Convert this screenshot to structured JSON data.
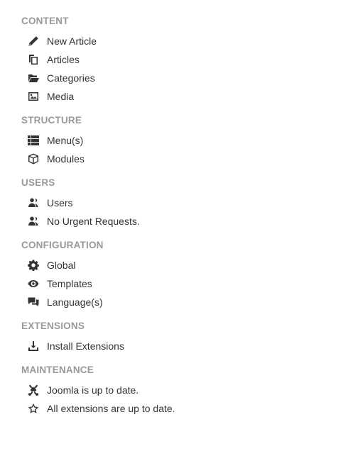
{
  "sections": {
    "content": {
      "title": "CONTENT",
      "items": [
        {
          "label": "New Article",
          "icon": "pencil-icon"
        },
        {
          "label": "Articles",
          "icon": "copy-icon"
        },
        {
          "label": "Categories",
          "icon": "folder-open-icon"
        },
        {
          "label": "Media",
          "icon": "image-icon"
        }
      ]
    },
    "structure": {
      "title": "STRUCTURE",
      "items": [
        {
          "label": "Menu(s)",
          "icon": "list-icon"
        },
        {
          "label": "Modules",
          "icon": "cube-icon"
        }
      ]
    },
    "users": {
      "title": "USERS",
      "items": [
        {
          "label": "Users",
          "icon": "users-icon"
        },
        {
          "label": "No Urgent Requests.",
          "icon": "users-icon"
        }
      ]
    },
    "configuration": {
      "title": "CONFIGURATION",
      "items": [
        {
          "label": "Global",
          "icon": "gear-icon"
        },
        {
          "label": "Templates",
          "icon": "eye-icon"
        },
        {
          "label": "Language(s)",
          "icon": "comments-icon"
        }
      ]
    },
    "extensions": {
      "title": "EXTENSIONS",
      "items": [
        {
          "label": "Install Extensions",
          "icon": "download-icon"
        }
      ]
    },
    "maintenance": {
      "title": "MAINTENANCE",
      "items": [
        {
          "label": "Joomla is up to date.",
          "icon": "joomla-icon"
        },
        {
          "label": "All extensions are up to date.",
          "icon": "star-outline-icon"
        }
      ]
    }
  }
}
